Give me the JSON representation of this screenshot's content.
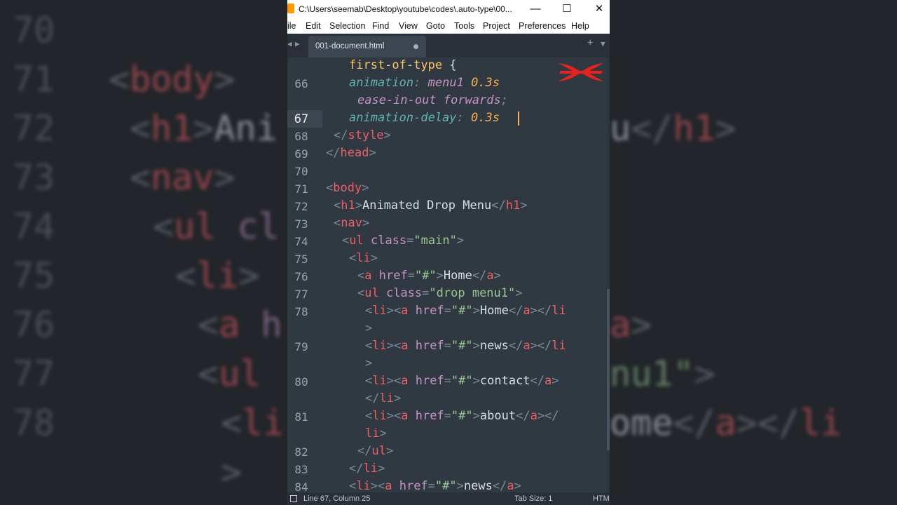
{
  "window": {
    "title": "C:\\Users\\seemab\\Desktop\\youtube\\codes\\.auto-type\\00...",
    "minimize_glyph": "—",
    "maximize_glyph": "☐",
    "close_glyph": "✕"
  },
  "menu": [
    "ile",
    "Edit",
    "Selection",
    "Find",
    "View",
    "Goto",
    "Tools",
    "Project",
    "Preferences",
    "Help"
  ],
  "tab": {
    "label": "001-document.html"
  },
  "code_lines": [
    {
      "num": "",
      "tokens": [
        {
          "c": "pv",
          "t": "first-of-type"
        },
        {
          "c": "w",
          "t": " {"
        }
      ]
    },
    {
      "num": "66",
      "italic": true,
      "tokens": [
        {
          "c": "ds",
          "t": "animation"
        },
        {
          "c": "p",
          "t": ":"
        },
        {
          "c": "w",
          "t": " "
        },
        {
          "c": "a",
          "t": "menu1"
        },
        {
          "c": "w",
          "t": " "
        },
        {
          "c": "n",
          "t": "0.3s"
        }
      ]
    },
    {
      "num": "",
      "italic": true,
      "tokens": [
        {
          "c": "a",
          "t": "ease-in-out"
        },
        {
          "c": "w",
          "t": " "
        },
        {
          "c": "a",
          "t": "forwards"
        },
        {
          "c": "p",
          "t": ";"
        }
      ]
    },
    {
      "num": "67",
      "italic": true,
      "tokens": [
        {
          "c": "ds",
          "t": "animation-delay"
        },
        {
          "c": "p",
          "t": ":"
        },
        {
          "c": "w",
          "t": " "
        },
        {
          "c": "n",
          "t": "0.3s"
        }
      ]
    },
    {
      "num": "68",
      "tokens": [
        {
          "c": "p",
          "t": "</"
        },
        {
          "c": "t",
          "t": "style"
        },
        {
          "c": "p",
          "t": ">"
        }
      ]
    },
    {
      "num": "69",
      "tokens": [
        {
          "c": "p",
          "t": "</"
        },
        {
          "c": "t",
          "t": "head"
        },
        {
          "c": "p",
          "t": ">"
        }
      ]
    },
    {
      "num": "70",
      "tokens": []
    },
    {
      "num": "71",
      "tokens": [
        {
          "c": "p",
          "t": "<"
        },
        {
          "c": "t",
          "t": "body"
        },
        {
          "c": "p",
          "t": ">"
        }
      ]
    },
    {
      "num": "72",
      "tokens": [
        {
          "c": "p",
          "t": "<"
        },
        {
          "c": "t",
          "t": "h1"
        },
        {
          "c": "p",
          "t": ">"
        },
        {
          "c": "w",
          "t": "Animated Drop Menu"
        },
        {
          "c": "p",
          "t": "</"
        },
        {
          "c": "t",
          "t": "h1"
        },
        {
          "c": "p",
          "t": ">"
        }
      ]
    },
    {
      "num": "73",
      "tokens": [
        {
          "c": "p",
          "t": "<"
        },
        {
          "c": "t",
          "t": "nav"
        },
        {
          "c": "p",
          "t": ">"
        }
      ]
    },
    {
      "num": "74",
      "tokens": [
        {
          "c": "p",
          "t": "<"
        },
        {
          "c": "t",
          "t": "ul"
        },
        {
          "c": "w",
          "t": " "
        },
        {
          "c": "a",
          "t": "class"
        },
        {
          "c": "p",
          "t": "="
        },
        {
          "c": "s",
          "t": "\"main\""
        },
        {
          "c": "p",
          "t": ">"
        }
      ]
    },
    {
      "num": "75",
      "tokens": [
        {
          "c": "p",
          "t": "<"
        },
        {
          "c": "t",
          "t": "li"
        },
        {
          "c": "p",
          "t": ">"
        }
      ]
    },
    {
      "num": "76",
      "tokens": [
        {
          "c": "p",
          "t": "<"
        },
        {
          "c": "t",
          "t": "a"
        },
        {
          "c": "w",
          "t": " "
        },
        {
          "c": "a",
          "t": "href"
        },
        {
          "c": "p",
          "t": "="
        },
        {
          "c": "s",
          "t": "\"#\""
        },
        {
          "c": "p",
          "t": ">"
        },
        {
          "c": "w",
          "t": "Home"
        },
        {
          "c": "p",
          "t": "</"
        },
        {
          "c": "t",
          "t": "a"
        },
        {
          "c": "p",
          "t": ">"
        }
      ]
    },
    {
      "num": "77",
      "tokens": [
        {
          "c": "p",
          "t": "<"
        },
        {
          "c": "t",
          "t": "ul"
        },
        {
          "c": "w",
          "t": " "
        },
        {
          "c": "a",
          "t": "class"
        },
        {
          "c": "p",
          "t": "="
        },
        {
          "c": "s",
          "t": "\"drop menu1\""
        },
        {
          "c": "p",
          "t": ">"
        }
      ]
    },
    {
      "num": "78",
      "tokens": [
        {
          "c": "p",
          "t": "<"
        },
        {
          "c": "t",
          "t": "li"
        },
        {
          "c": "p",
          "t": "><"
        },
        {
          "c": "t",
          "t": "a"
        },
        {
          "c": "w",
          "t": " "
        },
        {
          "c": "a",
          "t": "href"
        },
        {
          "c": "p",
          "t": "="
        },
        {
          "c": "s",
          "t": "\"#\""
        },
        {
          "c": "p",
          "t": ">"
        },
        {
          "c": "w",
          "t": "Home"
        },
        {
          "c": "p",
          "t": "</"
        },
        {
          "c": "t",
          "t": "a"
        },
        {
          "c": "p",
          "t": "></"
        },
        {
          "c": "t",
          "t": "li"
        }
      ]
    },
    {
      "num": "",
      "tokens": [
        {
          "c": "p",
          "t": ">"
        }
      ]
    },
    {
      "num": "79",
      "tokens": [
        {
          "c": "p",
          "t": "<"
        },
        {
          "c": "t",
          "t": "li"
        },
        {
          "c": "p",
          "t": "><"
        },
        {
          "c": "t",
          "t": "a"
        },
        {
          "c": "w",
          "t": " "
        },
        {
          "c": "a",
          "t": "href"
        },
        {
          "c": "p",
          "t": "="
        },
        {
          "c": "s",
          "t": "\"#\""
        },
        {
          "c": "p",
          "t": ">"
        },
        {
          "c": "w",
          "t": "news"
        },
        {
          "c": "p",
          "t": "</"
        },
        {
          "c": "t",
          "t": "a"
        },
        {
          "c": "p",
          "t": "></"
        },
        {
          "c": "t",
          "t": "li"
        }
      ]
    },
    {
      "num": "",
      "tokens": [
        {
          "c": "p",
          "t": ">"
        }
      ]
    },
    {
      "num": "80",
      "tokens": [
        {
          "c": "p",
          "t": "<"
        },
        {
          "c": "t",
          "t": "li"
        },
        {
          "c": "p",
          "t": "><"
        },
        {
          "c": "t",
          "t": "a"
        },
        {
          "c": "w",
          "t": " "
        },
        {
          "c": "a",
          "t": "href"
        },
        {
          "c": "p",
          "t": "="
        },
        {
          "c": "s",
          "t": "\"#\""
        },
        {
          "c": "p",
          "t": ">"
        },
        {
          "c": "w",
          "t": "contact"
        },
        {
          "c": "p",
          "t": "</"
        },
        {
          "c": "t",
          "t": "a"
        },
        {
          "c": "p",
          "t": ">"
        }
      ]
    },
    {
      "num": "",
      "tokens": [
        {
          "c": "p",
          "t": "</"
        },
        {
          "c": "t",
          "t": "li"
        },
        {
          "c": "p",
          "t": ">"
        }
      ]
    },
    {
      "num": "81",
      "tokens": [
        {
          "c": "p",
          "t": "<"
        },
        {
          "c": "t",
          "t": "li"
        },
        {
          "c": "p",
          "t": "><"
        },
        {
          "c": "t",
          "t": "a"
        },
        {
          "c": "w",
          "t": " "
        },
        {
          "c": "a",
          "t": "href"
        },
        {
          "c": "p",
          "t": "="
        },
        {
          "c": "s",
          "t": "\"#\""
        },
        {
          "c": "p",
          "t": ">"
        },
        {
          "c": "w",
          "t": "about"
        },
        {
          "c": "p",
          "t": "</"
        },
        {
          "c": "t",
          "t": "a"
        },
        {
          "c": "p",
          "t": "></"
        }
      ]
    },
    {
      "num": "",
      "tokens": [
        {
          "c": "t",
          "t": "li"
        },
        {
          "c": "p",
          "t": ">"
        }
      ]
    },
    {
      "num": "82",
      "tokens": [
        {
          "c": "p",
          "t": "</"
        },
        {
          "c": "t",
          "t": "ul"
        },
        {
          "c": "p",
          "t": ">"
        }
      ]
    },
    {
      "num": "83",
      "tokens": [
        {
          "c": "p",
          "t": "</"
        },
        {
          "c": "t",
          "t": "li"
        },
        {
          "c": "p",
          "t": ">"
        }
      ]
    },
    {
      "num": "84",
      "tokens": [
        {
          "c": "p",
          "t": "<"
        },
        {
          "c": "t",
          "t": "li"
        },
        {
          "c": "p",
          "t": "><"
        },
        {
          "c": "t",
          "t": "a"
        },
        {
          "c": "w",
          "t": " "
        },
        {
          "c": "a",
          "t": "href"
        },
        {
          "c": "p",
          "t": "="
        },
        {
          "c": "s",
          "t": "\"#\""
        },
        {
          "c": "p",
          "t": ">"
        },
        {
          "c": "w",
          "t": "news"
        },
        {
          "c": "p",
          "t": "</"
        },
        {
          "c": "t",
          "t": "a"
        },
        {
          "c": "p",
          "t": ">"
        }
      ]
    }
  ],
  "background_lines": [
    {
      "num": "70",
      "tokens": []
    },
    {
      "num": "71",
      "tokens": [
        {
          "c": "p",
          "t": "<"
        },
        {
          "c": "t",
          "t": "body"
        },
        {
          "c": "p",
          "t": ">"
        }
      ]
    },
    {
      "num": "72",
      "tokens": [
        {
          "c": "p",
          "t": "<"
        },
        {
          "c": "t",
          "t": "h1"
        },
        {
          "c": "p",
          "t": ">"
        },
        {
          "c": "w",
          "t": "Ani"
        }
      ]
    },
    {
      "num": "73",
      "tokens": [
        {
          "c": "p",
          "t": "<"
        },
        {
          "c": "t",
          "t": "nav"
        },
        {
          "c": "p",
          "t": ">"
        }
      ]
    },
    {
      "num": "74",
      "tokens": [
        {
          "c": "p",
          "t": "<"
        },
        {
          "c": "t",
          "t": "ul"
        },
        {
          "c": "w",
          "t": " "
        },
        {
          "c": "a",
          "t": "cl"
        }
      ]
    },
    {
      "num": "75",
      "tokens": [
        {
          "c": "p",
          "t": "<"
        },
        {
          "c": "t",
          "t": "li"
        },
        {
          "c": "p",
          "t": ">"
        }
      ]
    },
    {
      "num": "76",
      "tokens": [
        {
          "c": "p",
          "t": "<"
        },
        {
          "c": "t",
          "t": "a"
        },
        {
          "c": "w",
          "t": " "
        },
        {
          "c": "a",
          "t": "h"
        }
      ]
    },
    {
      "num": "77",
      "tokens": [
        {
          "c": "p",
          "t": "<"
        },
        {
          "c": "t",
          "t": "ul"
        }
      ]
    },
    {
      "num": "78",
      "tokens": [
        {
          "c": "p",
          "t": "<"
        },
        {
          "c": "t",
          "t": "li"
        }
      ]
    },
    {
      "num": "",
      "tokens": [
        {
          "c": "p",
          "t": ">"
        }
      ]
    }
  ],
  "background_right": [
    {
      "tokens": [
        {
          "c": "w",
          "t": "u"
        },
        {
          "c": "p",
          "t": "</"
        },
        {
          "c": "t",
          "t": "h1"
        },
        {
          "c": "p",
          "t": ">"
        }
      ]
    },
    {
      "tokens": [
        {
          "c": "t",
          "t": "a"
        },
        {
          "c": "p",
          "t": ">"
        }
      ]
    },
    {
      "tokens": [
        {
          "c": "s",
          "t": "nu1\""
        },
        {
          "c": "p",
          "t": ">"
        }
      ]
    },
    {
      "tokens": [
        {
          "c": "w",
          "t": "ome"
        },
        {
          "c": "p",
          "t": "</"
        },
        {
          "c": "t",
          "t": "a"
        },
        {
          "c": "p",
          "t": "></"
        },
        {
          "c": "t",
          "t": "li"
        }
      ]
    }
  ],
  "status": {
    "position": "Line 67, Column 25",
    "tab_size": "Tab Size: 1",
    "syntax": "HTM"
  },
  "colors": {
    "editor_bg": "#303841",
    "tag": "#ec5f67",
    "attribute": "#c594c5",
    "string": "#99c794",
    "number": "#f9ae58",
    "logo": "#e8231f"
  }
}
